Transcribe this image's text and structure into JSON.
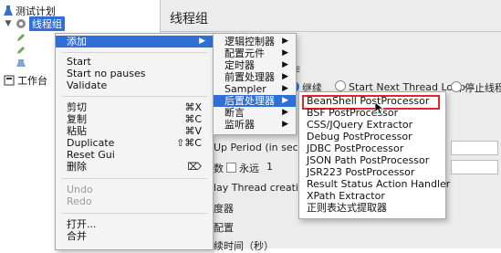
{
  "tree": {
    "root_label": "测试计划",
    "selected_label": "线程组",
    "workbench_label": "工作台"
  },
  "panel": {
    "title": "线程组",
    "action_label": "作",
    "continue_label": "继续",
    "next_loop_label": "Start Next Thread Loop",
    "stop_thread_label": "停止线程",
    "ramp_up_label": "Up Period (in secon",
    "loop_prefix": "数",
    "forever_label": "永远",
    "loop_value": "1",
    "delay_label": "lay Thread creation",
    "scheduler_label": "度器",
    "config_label": "配置",
    "duration_label": "续时间（秒）"
  },
  "context_menu": {
    "items": [
      {
        "label": "添加",
        "shortcut": "",
        "submenu": true,
        "active": true,
        "disabled": false
      },
      {
        "label": "Start",
        "shortcut": "",
        "submenu": false,
        "active": false,
        "disabled": false
      },
      {
        "label": "Start no pauses",
        "shortcut": "",
        "submenu": false,
        "active": false,
        "disabled": false
      },
      {
        "label": "Validate",
        "shortcut": "",
        "submenu": false,
        "active": false,
        "disabled": false
      },
      {
        "label": "剪切",
        "shortcut": "⌘X",
        "submenu": false,
        "active": false,
        "disabled": false
      },
      {
        "label": "复制",
        "shortcut": "⌘C",
        "submenu": false,
        "active": false,
        "disabled": false
      },
      {
        "label": "粘贴",
        "shortcut": "⌘V",
        "submenu": false,
        "active": false,
        "disabled": false
      },
      {
        "label": "Duplicate",
        "shortcut": "⇧⌘C",
        "submenu": false,
        "active": false,
        "disabled": false
      },
      {
        "label": "Reset Gui",
        "shortcut": "",
        "submenu": false,
        "active": false,
        "disabled": false
      },
      {
        "label": "删除",
        "shortcut": "⌦",
        "submenu": false,
        "active": false,
        "disabled": false
      },
      {
        "label": "Undo",
        "shortcut": "",
        "submenu": false,
        "active": false,
        "disabled": true
      },
      {
        "label": "Redo",
        "shortcut": "",
        "submenu": false,
        "active": false,
        "disabled": true
      },
      {
        "label": "打开...",
        "shortcut": "",
        "submenu": false,
        "active": false,
        "disabled": false
      },
      {
        "label": "合并",
        "shortcut": "",
        "submenu": false,
        "active": false,
        "disabled": false
      }
    ]
  },
  "add_submenu": {
    "items": [
      {
        "label": "逻辑控制器",
        "active": false
      },
      {
        "label": "配置元件",
        "active": false
      },
      {
        "label": "定时器",
        "active": false
      },
      {
        "label": "前置处理器",
        "active": false
      },
      {
        "label": "Sampler",
        "active": false
      },
      {
        "label": "后置处理器",
        "active": true
      },
      {
        "label": "断言",
        "active": false
      },
      {
        "label": "监听器",
        "active": false
      }
    ]
  },
  "post_processor_submenu": {
    "items": [
      {
        "label": "BeanShell PostProcessor",
        "highlighted": true
      },
      {
        "label": "BSF PostProcessor",
        "highlighted": false
      },
      {
        "label": "CSS/JQuery Extractor",
        "highlighted": false
      },
      {
        "label": "Debug PostProcessor",
        "highlighted": false
      },
      {
        "label": "JDBC PostProcessor",
        "highlighted": false
      },
      {
        "label": "JSON Path PostProcessor",
        "highlighted": false
      },
      {
        "label": "JSR223 PostProcessor",
        "highlighted": false
      },
      {
        "label": "Result Status Action Handler",
        "highlighted": false
      },
      {
        "label": "XPath Extractor",
        "highlighted": false
      },
      {
        "label": "正则表达式提取器",
        "highlighted": false
      }
    ]
  },
  "colors": {
    "selection": "#2f6fd6",
    "highlight_box": "#e0262a"
  }
}
